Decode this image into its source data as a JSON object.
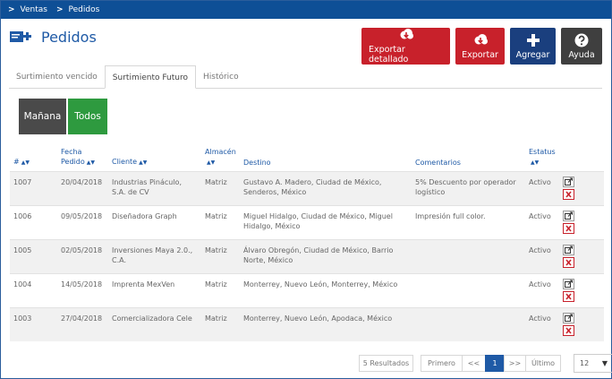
{
  "breadcrumb": [
    "Ventas",
    "Pedidos"
  ],
  "page_title": "Pedidos",
  "actions": {
    "export_detail": "Exportar detallado",
    "export": "Exportar",
    "add": "Agregar",
    "help": "Ayuda"
  },
  "tabs": [
    "Surtimiento vencido",
    "Surtimiento Futuro",
    "Histórico"
  ],
  "active_tab": 1,
  "filters": [
    "Mañana",
    "Todos"
  ],
  "columns": {
    "id": "#",
    "fecha_1": "Fecha",
    "fecha_2": "Pedido",
    "cliente": "Cliente",
    "almacen": "Almacén",
    "destino": "Destino",
    "comentarios": "Comentarios",
    "estatus": "Estatus"
  },
  "rows": [
    {
      "id": "1007",
      "fecha": "20/04/2018",
      "cliente": "Industrias Pináculo, S.A. de CV",
      "almacen": "Matriz",
      "destino": "Gustavo A. Madero, Ciudad de México, Senderos, México",
      "comentarios": "5% Descuento por operador logístico",
      "estatus": "Activo"
    },
    {
      "id": "1006",
      "fecha": "09/05/2018",
      "cliente": "Diseñadora Graph",
      "almacen": "Matriz",
      "destino": "Miguel Hidalgo, Ciudad de México, Miguel Hidalgo, México",
      "comentarios": "Impresión full color.",
      "estatus": "Activo"
    },
    {
      "id": "1005",
      "fecha": "02/05/2018",
      "cliente": "Inversiones Maya 2.0., C.A.",
      "almacen": "Matriz",
      "destino": "Álvaro Obregón, Ciudad de México, Barrio Norte, México",
      "comentarios": "",
      "estatus": "Activo"
    },
    {
      "id": "1004",
      "fecha": "14/05/2018",
      "cliente": "Imprenta MexVen",
      "almacen": "Matriz",
      "destino": "Monterrey, Nuevo León, Monterrey, México",
      "comentarios": "",
      "estatus": "Activo"
    },
    {
      "id": "1003",
      "fecha": "27/04/2018",
      "cliente": "Comercializadora Cele",
      "almacen": "Matriz",
      "destino": "Monterrey, Nuevo León, Apodaca, México",
      "comentarios": "",
      "estatus": "Activo"
    }
  ],
  "pagination": {
    "results": "5 Resultados",
    "first": "Primero",
    "prev": "<<",
    "current": "1",
    "next": ">>",
    "last": "Último"
  },
  "page_size": "12",
  "colors": {
    "navy": "#0e4f96",
    "red": "#c8212b",
    "green": "#2e9a3f",
    "link": "#1f5aa6"
  }
}
